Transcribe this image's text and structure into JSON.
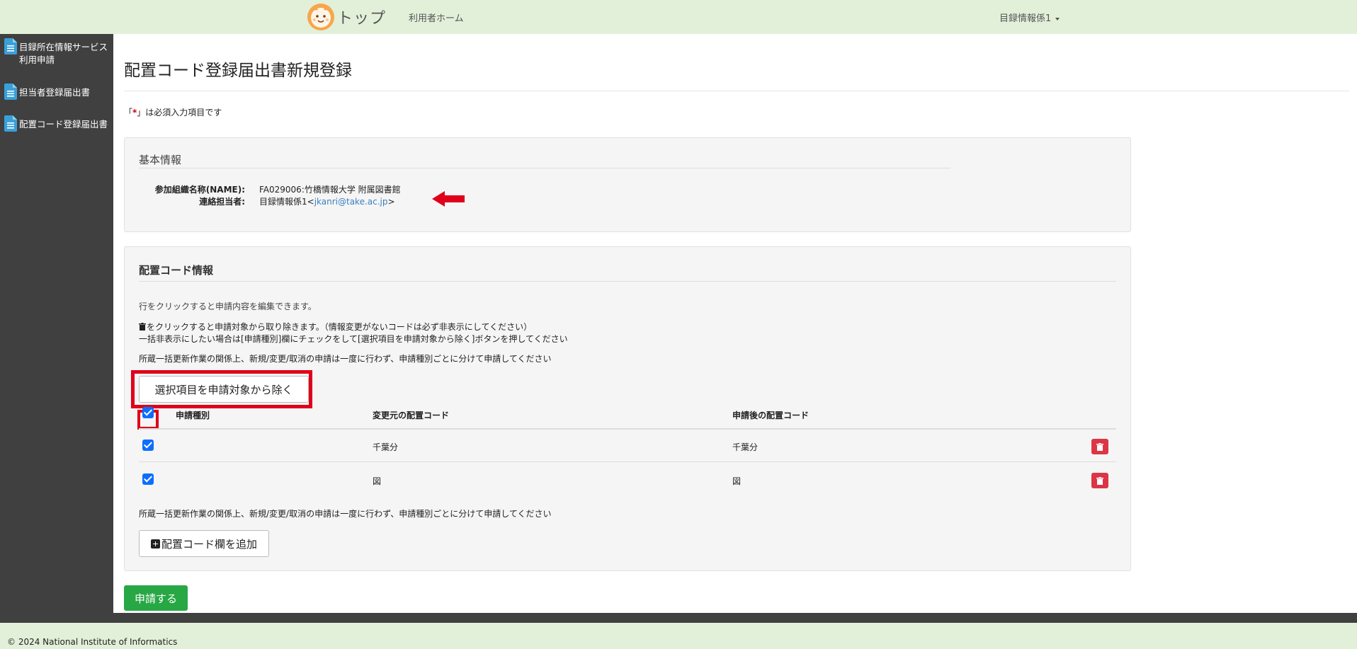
{
  "navbar": {
    "brand_text": "トップ",
    "home_link": "利用者ホーム",
    "user_menu": "目録情報係1"
  },
  "sidebar": {
    "items": [
      {
        "label": "目録所在情報サービス利用申請"
      },
      {
        "label": "担当者登録届出書"
      },
      {
        "label": "配置コード登録届出書"
      }
    ]
  },
  "main": {
    "title": "配置コード登録届出書新規登録",
    "required_note_prefix": "「",
    "required_note_star": "*",
    "required_note_suffix": "」は必須入力項目です"
  },
  "basic_info": {
    "legend": "基本情報",
    "org_label": "参加組織名称(NAME):",
    "org_value": "FA029006:竹橋情報大学 附属図書館",
    "contact_label": "連絡担当者:",
    "contact_name": "目録情報係1<",
    "contact_email": "jkanri@take.ac.jp",
    "contact_suffix": ">"
  },
  "code_info": {
    "legend": "配置コード情報",
    "help1": "行をクリックすると申請内容を編集できます。",
    "help2": "をクリックすると申請対象から取り除きます。（情報変更がないコードは必ず非表示にしてください）",
    "help3": "一括非表示にしたい場合は[申請種別]欄にチェックをして[選択項目を申請対象から除く]ボタンを押してください",
    "help4": "所蔵一括更新作業の関係上、新規/変更/取消の申請は一度に行わず、申請種別ごとに分けて申請してください",
    "exclude_button": "選択項目を申請対象から除く",
    "columns": [
      "申請種別",
      "変更元の配置コード",
      "申請後の配置コード"
    ],
    "rows": [
      {
        "type": "",
        "from": "千葉分",
        "to": "千葉分",
        "checked": true
      },
      {
        "type": "",
        "from": "図",
        "to": "図",
        "checked": true
      }
    ],
    "help5": "所蔵一括更新作業の関係上、新規/変更/取消の申請は一度に行わず、申請種別ごとに分けて申請してください",
    "add_button": "配置コード欄を追加"
  },
  "submit_button": "申請する",
  "footer": "© 2024 National Institute of Informatics",
  "colors": {
    "navbar_bg": "#e2f0d9",
    "sidebar_bg": "#404040",
    "submit_green": "#28a745",
    "delete_red": "#dc3545",
    "highlight_red": "#e0001a",
    "link_blue": "#3a7fc1"
  }
}
